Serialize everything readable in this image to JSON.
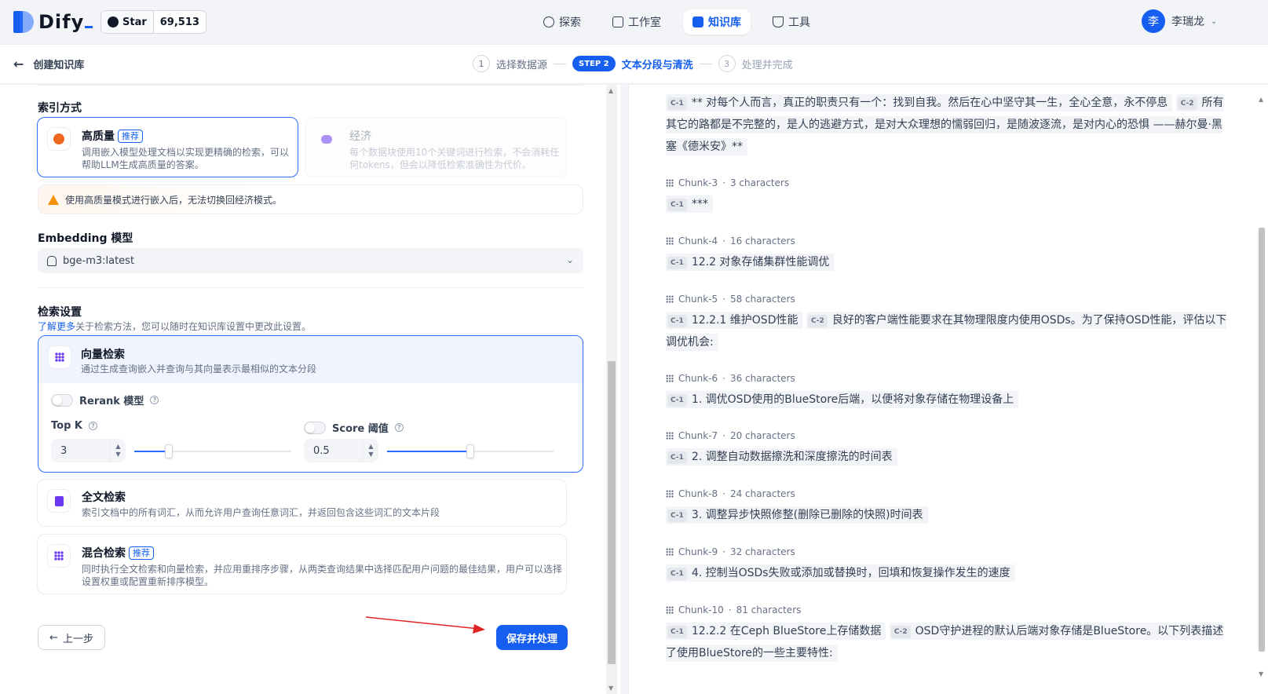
{
  "app": {
    "logo_text": "Dify",
    "github": {
      "star_label": "Star",
      "star_count": "69,513"
    },
    "nav": [
      {
        "label": "探索",
        "icon": "compass-icon",
        "active": false
      },
      {
        "label": "工作室",
        "icon": "robot-icon",
        "active": false
      },
      {
        "label": "知识库",
        "icon": "book-icon",
        "active": true
      },
      {
        "label": "工具",
        "icon": "hammer-icon",
        "active": false
      }
    ],
    "user": {
      "avatar_initial": "李",
      "name": "李瑞龙"
    }
  },
  "subheader": {
    "back_label": "创建知识库",
    "steps": [
      {
        "num": "1",
        "label": "选择数据源"
      },
      {
        "num": "STEP 2",
        "label": "文本分段与清洗"
      },
      {
        "num": "3",
        "label": "处理并完成"
      }
    ]
  },
  "index": {
    "title": "索引方式",
    "high_quality": {
      "title": "高质量",
      "badge": "推荐",
      "desc1": "调用嵌入模型处理文档以实现更精确的检索，可以",
      "desc2": "帮助LLM生成高质量的答案。"
    },
    "economy": {
      "title": "经济",
      "desc1": "每个数据块使用10个关键词进行检索，不会消耗任",
      "desc2": "何tokens，但会以降低检索准确性为代价。"
    },
    "warning": "使用高质量模式进行嵌入后，无法切换回经济模式。"
  },
  "embedding": {
    "title": "Embedding 模型",
    "value": "bge-m3:latest"
  },
  "retrieval": {
    "title": "检索设置",
    "learn_more": "了解更多",
    "learn_rest": "关于检索方法，您可以随时在知识库设置中更改此设置。",
    "vector": {
      "title": "向量检索",
      "desc": "通过生成查询嵌入并查询与其向量表示最相似的文本分段",
      "rerank_label": "Rerank 模型",
      "topk_label": "Top K",
      "topk_value": "3",
      "topk_fraction": 0.22,
      "score_label": "Score 阈值",
      "score_value": "0.5",
      "score_fraction": 0.5
    },
    "fulltext": {
      "title": "全文检索",
      "desc": "索引文档中的所有词汇，从而允许用户查询任意词汇，并返回包含这些词汇的文本片段"
    },
    "hybrid": {
      "title": "混合检索",
      "badge": "推荐",
      "desc1": "同时执行全文检索和向量检索，并应用重排序步骤，从两类查询结果中选择匹配用户问题的最佳结果，用户可以选择",
      "desc2": "设置权重或配置重新排序模型。"
    }
  },
  "actions": {
    "prev": "上一步",
    "save": "保存并处理"
  },
  "preview": {
    "top_c1": "C-1",
    "top_seg1": "** 对每个人而言，真正的职责只有一个：找到自我。然后在心中坚守其一生，全心全意，永不停息",
    "top_c2": "C-2",
    "top_seg2": "所有其它的路都是不完整的，是人的逃避方式，是对大众理想的懦弱回归，是随波逐流，是对内心的恐惧 ——赫尔曼·黑塞《德米安》**",
    "chunks": [
      {
        "id": "Chunk-3",
        "chars": "3 characters",
        "parts": [
          {
            "tag": "C-1",
            "text": "***"
          }
        ]
      },
      {
        "id": "Chunk-4",
        "chars": "16 characters",
        "parts": [
          {
            "tag": "C-1",
            "text": "12.2 对象存储集群性能调优"
          }
        ]
      },
      {
        "id": "Chunk-5",
        "chars": "58 characters",
        "parts": [
          {
            "tag": "C-1",
            "text": "12.2.1 维护OSD性能"
          },
          {
            "tag": "C-2",
            "text": "良好的客户端性能要求在其物理限度内使用OSDs。为了保持OSD性能，评估以下调优机会:"
          }
        ]
      },
      {
        "id": "Chunk-6",
        "chars": "36 characters",
        "parts": [
          {
            "tag": "C-1",
            "text": "1. 调优OSD使用的BlueStore后端，以便将对象存储在物理设备上"
          }
        ]
      },
      {
        "id": "Chunk-7",
        "chars": "20 characters",
        "parts": [
          {
            "tag": "C-1",
            "text": "2. 调整自动数据擦洗和深度擦洗的时间表"
          }
        ]
      },
      {
        "id": "Chunk-8",
        "chars": "24 characters",
        "parts": [
          {
            "tag": "C-1",
            "text": "3. 调整异步快照修整(删除已删除的快照)时间表"
          }
        ]
      },
      {
        "id": "Chunk-9",
        "chars": "32 characters",
        "parts": [
          {
            "tag": "C-1",
            "text": "4. 控制当OSDs失败或添加或替换时，回填和恢复操作发生的速度"
          }
        ]
      },
      {
        "id": "Chunk-10",
        "chars": "81 characters",
        "parts": [
          {
            "tag": "C-1",
            "text": "12.2.2 在Ceph BlueStore上存储数据"
          },
          {
            "tag": "C-2",
            "text": "OSD守护进程的默认后端对象存储是BlueStore。以下列表描述了使用BlueStore的一些主要特性:"
          }
        ]
      }
    ]
  }
}
